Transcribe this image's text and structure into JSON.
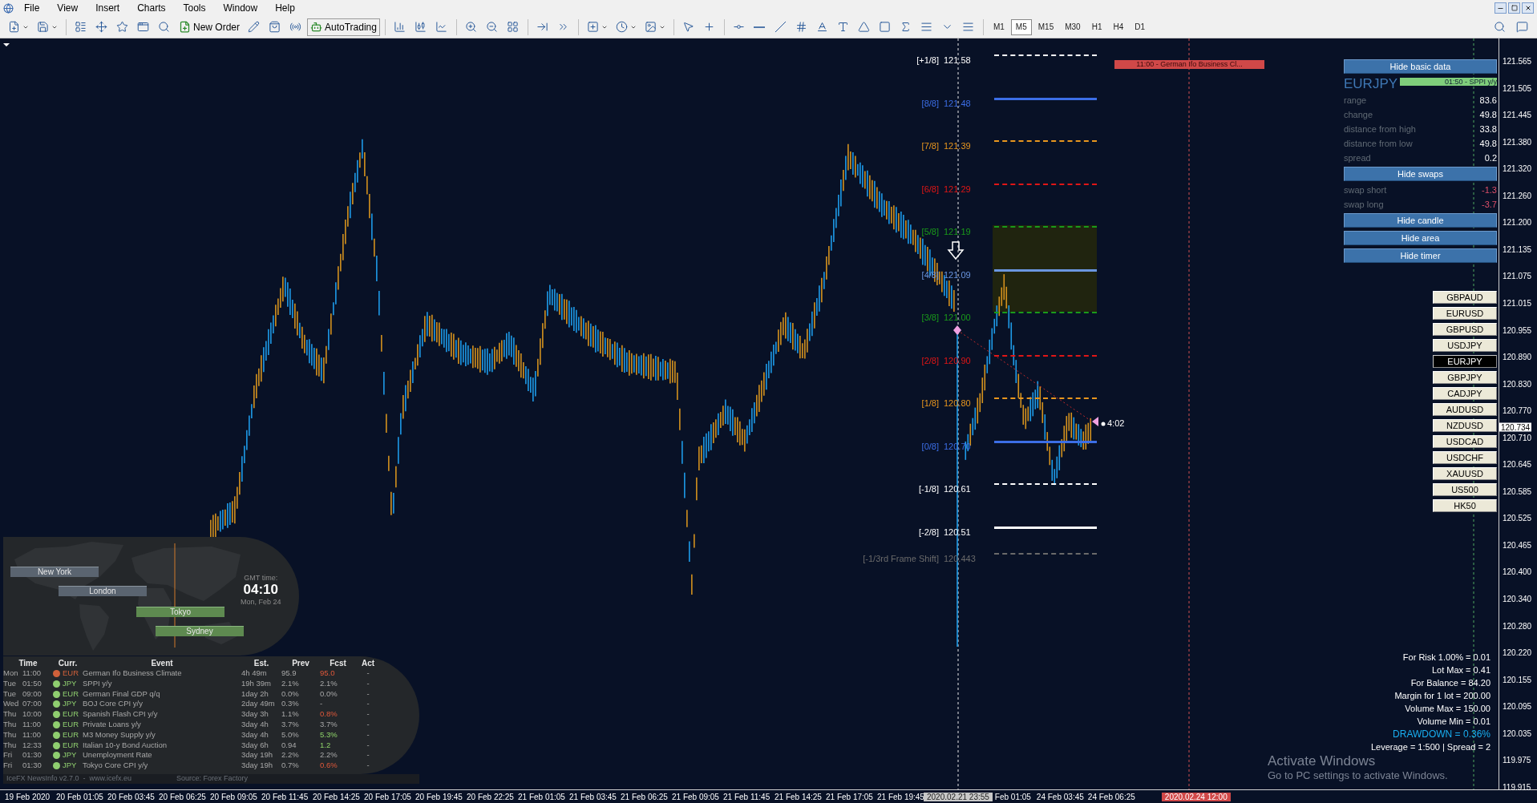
{
  "menu": [
    "File",
    "View",
    "Insert",
    "Charts",
    "Tools",
    "Window",
    "Help"
  ],
  "toolbar": {
    "new_order": "New Order",
    "auto_trading": "AutoTrading",
    "timeframes": [
      {
        "label": "M1",
        "selected": false
      },
      {
        "label": "M5",
        "selected": true
      },
      {
        "label": "M15",
        "selected": false
      },
      {
        "label": "M30",
        "selected": false
      },
      {
        "label": "H1",
        "selected": false
      },
      {
        "label": "H4",
        "selected": false
      },
      {
        "label": "D1",
        "selected": false
      }
    ]
  },
  "fib_levels": [
    {
      "label": "[+1/8]",
      "price": "121.58",
      "color": "#ffffff",
      "dashed": true
    },
    {
      "label": "[8/8]",
      "price": "121.48",
      "color": "#3c6ee6",
      "dashed": false
    },
    {
      "label": "[7/8]",
      "price": "121.39",
      "color": "#e8961e",
      "dashed": true
    },
    {
      "label": "[6/8]",
      "price": "121.29",
      "color": "#e01616",
      "dashed": true
    },
    {
      "label": "[5/8]",
      "price": "121.19",
      "color": "#1a9a1a",
      "dashed": true
    },
    {
      "label": "[4/8]",
      "price": "121.09",
      "color": "#6a96e0",
      "dashed": false
    },
    {
      "label": "[3/8]",
      "price": "121.00",
      "color": "#1a9a1a",
      "dashed": true
    },
    {
      "label": "[2/8]",
      "price": "120.90",
      "color": "#e01616",
      "dashed": true
    },
    {
      "label": "[1/8]",
      "price": "120.80",
      "color": "#e8961e",
      "dashed": true
    },
    {
      "label": "[0/8]",
      "price": "120.70",
      "color": "#3c6ee6",
      "dashed": false
    },
    {
      "label": "[-1/8]",
      "price": "120.61",
      "color": "#ffffff",
      "dashed": true
    },
    {
      "label": "[-2/8]",
      "price": "120.51",
      "color": "#ffffff",
      "dashed": false
    },
    {
      "label": "[-1/3rd Frame Shift]",
      "price": "120.443",
      "color": "#6a6a6a",
      "dashed": true
    }
  ],
  "event_marker": "11:00 - German Ifo Business Cl...",
  "timer": "4:02",
  "info_panel": {
    "hide_basic": "Hide basic data",
    "symbol": "EURJPY",
    "ticker": "01:50 - SPPI y/y",
    "stats": [
      {
        "label": "range",
        "value": "83.6"
      },
      {
        "label": "change",
        "value": "49.8"
      },
      {
        "label": "distance from high",
        "value": "33.8"
      },
      {
        "label": "distance from low",
        "value": "49.8"
      },
      {
        "label": "spread",
        "value": "0.2"
      }
    ],
    "hide_swaps": "Hide swaps",
    "swaps": [
      {
        "label": "swap short",
        "value": "-1.3"
      },
      {
        "label": "swap long",
        "value": "-3.7"
      }
    ],
    "buttons": [
      "Hide candle",
      "Hide area",
      "Hide timer"
    ]
  },
  "symbols": [
    {
      "label": "GBPAUD",
      "selected": false
    },
    {
      "label": "EURUSD",
      "selected": false
    },
    {
      "label": "GBPUSD",
      "selected": false
    },
    {
      "label": "USDJPY",
      "selected": false
    },
    {
      "label": "EURJPY",
      "selected": true
    },
    {
      "label": "GBPJPY",
      "selected": false
    },
    {
      "label": "CADJPY",
      "selected": false
    },
    {
      "label": "AUDUSD",
      "selected": false
    },
    {
      "label": "NZDUSD",
      "selected": false
    },
    {
      "label": "USDCAD",
      "selected": false
    },
    {
      "label": "USDCHF",
      "selected": false
    },
    {
      "label": "XAUUSD",
      "selected": false
    },
    {
      "label": "US500",
      "selected": false
    },
    {
      "label": "HK50",
      "selected": false
    }
  ],
  "risk_lines": [
    {
      "text": "For Risk 1.00% = 0.01",
      "kind": "plain"
    },
    {
      "text": "Lot Max = 0.41",
      "kind": "plain"
    },
    {
      "text": "For Balance = 84.20",
      "kind": "plain"
    },
    {
      "text": "Margin for 1 lot = 200.00",
      "kind": "plain"
    },
    {
      "text": "Volume Max = 150.00",
      "kind": "plain"
    },
    {
      "text": "Volume Min = 0.01",
      "kind": "plain"
    },
    {
      "text": "DRAWDOWN =  0.36%",
      "kind": "highlight"
    },
    {
      "text": "Leverage = 1:500 | Spread = 2",
      "kind": "plain"
    }
  ],
  "sessions": {
    "cities": [
      {
        "name": "New York",
        "active": false
      },
      {
        "name": "London",
        "active": false
      },
      {
        "name": "Tokyo",
        "active": true
      },
      {
        "name": "Sydney",
        "active": true
      }
    ],
    "gmt_label": "GMT time:",
    "gmt_time": "04:10",
    "gmt_date": "Mon, Feb 24"
  },
  "news": {
    "columns": [
      "Time",
      "Curr.",
      "Event",
      "Est.",
      "Prev",
      "Fcst",
      "Act"
    ],
    "rows": [
      {
        "day": "Mon",
        "time": "11:00",
        "color": "#d0603a",
        "currency": "EUR",
        "event": "German Ifo Business Climate",
        "est": "4h 49m",
        "prev": "95.9",
        "fcst": {
          "text": "95.0",
          "kind": "lower"
        },
        "act": "-"
      },
      {
        "day": "Tue",
        "time": "01:50",
        "color": "#8fce6f",
        "currency": "JPY",
        "event": "SPPI y/y",
        "est": "19h 39m",
        "prev": "2.1%",
        "fcst": {
          "text": "2.1%",
          "kind": "same"
        },
        "act": "-"
      },
      {
        "day": "Tue",
        "time": "09:00",
        "color": "#8fce6f",
        "currency": "EUR",
        "event": "German Final GDP q/q",
        "est": "1day 2h",
        "prev": "0.0%",
        "fcst": {
          "text": "0.0%",
          "kind": "same"
        },
        "act": "-"
      },
      {
        "day": "Wed",
        "time": "07:00",
        "color": "#8fce6f",
        "currency": "JPY",
        "event": "BOJ Core CPI y/y",
        "est": "2day 49m",
        "prev": "0.3%",
        "fcst": {
          "text": "-",
          "kind": "same"
        },
        "act": "-"
      },
      {
        "day": "Thu",
        "time": "10:00",
        "color": "#8fce6f",
        "currency": "EUR",
        "event": "Spanish Flash CPI y/y",
        "est": "3day 3h",
        "prev": "1.1%",
        "fcst": {
          "text": "0.8%",
          "kind": "lower"
        },
        "act": "-"
      },
      {
        "day": "Thu",
        "time": "11:00",
        "color": "#8fce6f",
        "currency": "EUR",
        "event": "Private Loans y/y",
        "est": "3day 4h",
        "prev": "3.7%",
        "fcst": {
          "text": "3.7%",
          "kind": "same"
        },
        "act": "-"
      },
      {
        "day": "Thu",
        "time": "11:00",
        "color": "#8fce6f",
        "currency": "EUR",
        "event": "M3 Money Supply y/y",
        "est": "3day 4h",
        "prev": "5.0%",
        "fcst": {
          "text": "5.3%",
          "kind": "higher"
        },
        "act": "-"
      },
      {
        "day": "Thu",
        "time": "12:33",
        "color": "#8fce6f",
        "currency": "EUR",
        "event": "Italian 10-y Bond Auction",
        "est": "3day 6h",
        "prev": "0.94",
        "fcst": {
          "text": "1.2",
          "kind": "higher"
        },
        "act": "-"
      },
      {
        "day": "Fri",
        "time": "01:30",
        "color": "#8fce6f",
        "currency": "JPY",
        "event": "Unemployment Rate",
        "est": "3day 19h",
        "prev": "2.2%",
        "fcst": {
          "text": "2.2%",
          "kind": "same"
        },
        "act": "-"
      },
      {
        "day": "Fri",
        "time": "01:30",
        "color": "#8fce6f",
        "currency": "JPY",
        "event": "Tokyo Core CPI y/y",
        "est": "3day 19h",
        "prev": "0.7%",
        "fcst": {
          "text": "0.6%",
          "kind": "lower"
        },
        "act": "-"
      }
    ],
    "footer_left": "IceFX NewsInfo v2.7.0  -  www.icefx.eu",
    "footer_right": "Source: Forex Factory"
  },
  "price_axis": {
    "labels": [
      "121.565",
      "121.505",
      "121.445",
      "121.380",
      "121.320",
      "121.260",
      "121.200",
      "121.135",
      "121.075",
      "121.015",
      "120.955",
      "120.890",
      "120.830",
      "120.770",
      "120.710",
      "120.645",
      "120.585",
      "120.525",
      "120.465",
      "120.400",
      "120.340",
      "120.280",
      "120.220",
      "120.155",
      "120.095",
      "120.035",
      "119.975",
      "119.915"
    ],
    "current": "120.734"
  },
  "time_axis": [
    {
      "text": "19 Feb 2020",
      "kind": "plain"
    },
    {
      "text": "20 Feb 01:05",
      "kind": "plain"
    },
    {
      "text": "20 Feb 03:45",
      "kind": "plain"
    },
    {
      "text": "20 Feb 06:25",
      "kind": "plain"
    },
    {
      "text": "20 Feb 09:05",
      "kind": "plain"
    },
    {
      "text": "20 Feb 11:45",
      "kind": "plain"
    },
    {
      "text": "20 Feb 14:25",
      "kind": "plain"
    },
    {
      "text": "20 Feb 17:05",
      "kind": "plain"
    },
    {
      "text": "20 Feb 19:45",
      "kind": "plain"
    },
    {
      "text": "20 Feb 22:25",
      "kind": "plain"
    },
    {
      "text": "21 Feb 01:05",
      "kind": "plain"
    },
    {
      "text": "21 Feb 03:45",
      "kind": "plain"
    },
    {
      "text": "21 Feb 06:25",
      "kind": "plain"
    },
    {
      "text": "21 Feb 09:05",
      "kind": "plain"
    },
    {
      "text": "21 Feb 11:45",
      "kind": "plain"
    },
    {
      "text": "21 Feb 14:25",
      "kind": "plain"
    },
    {
      "text": "21 Feb 17:05",
      "kind": "plain"
    },
    {
      "text": "21 Feb 19:45",
      "kind": "plain"
    },
    {
      "text": "2020.02.21 23:55",
      "kind": "cursor"
    },
    {
      "text": "Feb 01:05",
      "kind": "short"
    },
    {
      "text": "24 Feb 03:45",
      "kind": "plain"
    },
    {
      "text": "24 Feb 06:25",
      "kind": "plain"
    },
    {
      "text": "2020.02.24 12:00",
      "kind": "event"
    }
  ],
  "activation": {
    "title": "Activate Windows",
    "subtitle": "Go to PC settings to activate Windows."
  }
}
